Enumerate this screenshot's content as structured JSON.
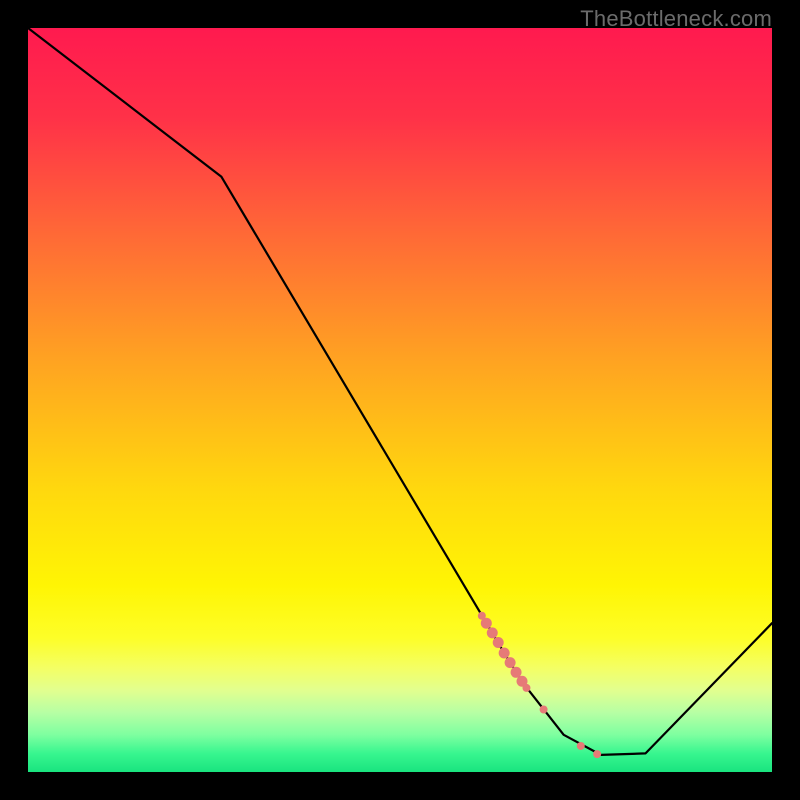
{
  "watermark": "TheBottleneck.com",
  "chart_data": {
    "type": "line",
    "title": "",
    "xlabel": "",
    "ylabel": "",
    "xlim": [
      0,
      100
    ],
    "ylim": [
      0,
      100
    ],
    "series": [
      {
        "name": "bottleneck-curve",
        "x": [
          0,
          26,
          64,
          66.5,
          72,
          77,
          83,
          100
        ],
        "values": [
          100,
          80,
          16,
          12,
          5,
          2.3,
          2.5,
          20
        ],
        "stroke": "#000000"
      }
    ],
    "markers": [
      {
        "name": "marker-segment-top",
        "x": 61,
        "y": 21,
        "r": 4.0,
        "color": "#e67a77"
      },
      {
        "name": "marker-segment-1",
        "x": 61.6,
        "y": 20,
        "r": 5.5,
        "color": "#e67a77"
      },
      {
        "name": "marker-segment-2",
        "x": 62.4,
        "y": 18.7,
        "r": 5.5,
        "color": "#e67a77"
      },
      {
        "name": "marker-segment-3",
        "x": 63.2,
        "y": 17.4,
        "r": 5.5,
        "color": "#e67a77"
      },
      {
        "name": "marker-segment-4",
        "x": 64.0,
        "y": 16.0,
        "r": 5.5,
        "color": "#e67a77"
      },
      {
        "name": "marker-segment-5",
        "x": 64.8,
        "y": 14.7,
        "r": 5.5,
        "color": "#e67a77"
      },
      {
        "name": "marker-segment-6",
        "x": 65.6,
        "y": 13.4,
        "r": 5.5,
        "color": "#e67a77"
      },
      {
        "name": "marker-segment-7",
        "x": 66.4,
        "y": 12.2,
        "r": 5.5,
        "color": "#e67a77"
      },
      {
        "name": "marker-segment-bottom",
        "x": 67,
        "y": 11.3,
        "r": 4.0,
        "color": "#e67a77"
      },
      {
        "name": "marker-isolated-upper",
        "x": 69.3,
        "y": 8.4,
        "r": 4.0,
        "color": "#e67a77"
      },
      {
        "name": "marker-isolated-mid",
        "x": 74.3,
        "y": 3.5,
        "r": 4.0,
        "color": "#e67a77"
      },
      {
        "name": "marker-isolated-lower",
        "x": 76.5,
        "y": 2.4,
        "r": 4.0,
        "color": "#e67a77"
      }
    ],
    "background_gradient": {
      "type": "vertical",
      "stops": [
        {
          "pos": 0.0,
          "color": "#ff1a4f"
        },
        {
          "pos": 0.12,
          "color": "#ff3148"
        },
        {
          "pos": 0.28,
          "color": "#ff6a36"
        },
        {
          "pos": 0.45,
          "color": "#ffa421"
        },
        {
          "pos": 0.62,
          "color": "#ffd80e"
        },
        {
          "pos": 0.75,
          "color": "#fff504"
        },
        {
          "pos": 0.82,
          "color": "#fdfe28"
        },
        {
          "pos": 0.86,
          "color": "#f4ff64"
        },
        {
          "pos": 0.89,
          "color": "#e2ff8f"
        },
        {
          "pos": 0.92,
          "color": "#b7ffa4"
        },
        {
          "pos": 0.95,
          "color": "#7effa0"
        },
        {
          "pos": 0.975,
          "color": "#38f68f"
        },
        {
          "pos": 1.0,
          "color": "#19e47f"
        }
      ]
    }
  }
}
